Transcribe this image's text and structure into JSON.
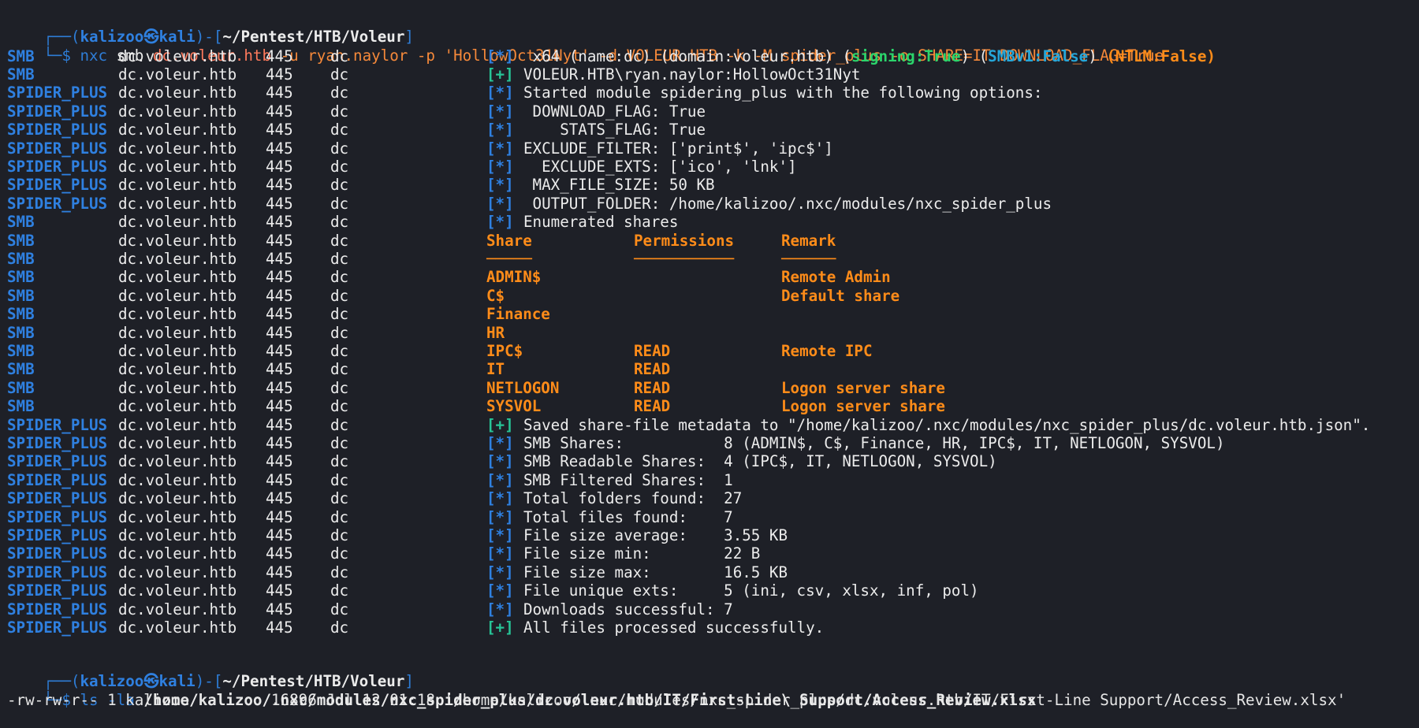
{
  "colors": {
    "background": "#1e2027",
    "prompt_user": "#2f80e0",
    "info_tag": "#2f80e0",
    "success_tag": "#27c497",
    "heading": "#ff8c19",
    "signing": "#2bd46b",
    "smbv1": "#25a6d9"
  },
  "prompt1": {
    "corner": "┌──(",
    "user": "kalizoo",
    "skull": "㉿",
    "host": "kali",
    "mid": ")-[",
    "path": "~/Pentest/HTB/Voleur",
    "end": "]",
    "arrow": "└─$",
    "cmd": "nxc",
    "args": " smb ",
    "target": "dc.voleur.htb",
    "rest": " -u ryan.naylor -p 'HollowOct31Nyt' -d VOLEUR.HTB -k -M spider_plus -o SHARE=IT DOWNLOAD_FLAG=True"
  },
  "rows": [
    {
      "proto": "SMB",
      "host": "dc.voleur.htb",
      "port": "445",
      "name": "dc",
      "tag": "[*]",
      "text": " x64 (name:dc) (domain:voleur.htb) (",
      "signing": "signing:True",
      "t2": ") (",
      "smbv1": "SMBv1:False",
      "t3": ") ",
      "ntlm": "(NTLM:False)"
    },
    {
      "proto": "SMB",
      "host": "dc.voleur.htb",
      "port": "445",
      "name": "dc",
      "tag": "[+]",
      "text": "VOLEUR.HTB\\ryan.naylor:HollowOct31Nyt"
    },
    {
      "proto": "SPIDER_PLUS",
      "host": "dc.voleur.htb",
      "port": "445",
      "name": "dc",
      "tag": "[*]",
      "text": "Started module spidering_plus with the following options:"
    },
    {
      "proto": "SPIDER_PLUS",
      "host": "dc.voleur.htb",
      "port": "445",
      "name": "dc",
      "tag": "[*]",
      "text": " DOWNLOAD_FLAG: True"
    },
    {
      "proto": "SPIDER_PLUS",
      "host": "dc.voleur.htb",
      "port": "445",
      "name": "dc",
      "tag": "[*]",
      "text": "    STATS_FLAG: True"
    },
    {
      "proto": "SPIDER_PLUS",
      "host": "dc.voleur.htb",
      "port": "445",
      "name": "dc",
      "tag": "[*]",
      "text": "EXCLUDE_FILTER: ['print$', 'ipc$']"
    },
    {
      "proto": "SPIDER_PLUS",
      "host": "dc.voleur.htb",
      "port": "445",
      "name": "dc",
      "tag": "[*]",
      "text": "  EXCLUDE_EXTS: ['ico', 'lnk']"
    },
    {
      "proto": "SPIDER_PLUS",
      "host": "dc.voleur.htb",
      "port": "445",
      "name": "dc",
      "tag": "[*]",
      "text": " MAX_FILE_SIZE: 50 KB"
    },
    {
      "proto": "SPIDER_PLUS",
      "host": "dc.voleur.htb",
      "port": "445",
      "name": "dc",
      "tag": "[*]",
      "text": " OUTPUT_FOLDER: /home/kalizoo/.nxc/modules/nxc_spider_plus"
    },
    {
      "proto": "SMB",
      "host": "dc.voleur.htb",
      "port": "445",
      "name": "dc",
      "tag": "[*]",
      "text": "Enumerated shares"
    },
    {
      "proto": "SMB",
      "host": "dc.voleur.htb",
      "port": "445",
      "name": "dc",
      "share": "Share",
      "perm": "Permissions",
      "remark": "Remark"
    },
    {
      "proto": "SMB",
      "host": "dc.voleur.htb",
      "port": "445",
      "name": "dc",
      "share": "─────",
      "perm": "───────────",
      "remark": "──────"
    },
    {
      "proto": "SMB",
      "host": "dc.voleur.htb",
      "port": "445",
      "name": "dc",
      "share": "ADMIN$",
      "perm": "",
      "remark": "Remote Admin"
    },
    {
      "proto": "SMB",
      "host": "dc.voleur.htb",
      "port": "445",
      "name": "dc",
      "share": "C$",
      "perm": "",
      "remark": "Default share"
    },
    {
      "proto": "SMB",
      "host": "dc.voleur.htb",
      "port": "445",
      "name": "dc",
      "share": "Finance",
      "perm": "",
      "remark": ""
    },
    {
      "proto": "SMB",
      "host": "dc.voleur.htb",
      "port": "445",
      "name": "dc",
      "share": "HR",
      "perm": "",
      "remark": ""
    },
    {
      "proto": "SMB",
      "host": "dc.voleur.htb",
      "port": "445",
      "name": "dc",
      "share": "IPC$",
      "perm": "READ",
      "remark": "Remote IPC"
    },
    {
      "proto": "SMB",
      "host": "dc.voleur.htb",
      "port": "445",
      "name": "dc",
      "share": "IT",
      "perm": "READ",
      "remark": ""
    },
    {
      "proto": "SMB",
      "host": "dc.voleur.htb",
      "port": "445",
      "name": "dc",
      "share": "NETLOGON",
      "perm": "READ",
      "remark": "Logon server share"
    },
    {
      "proto": "SMB",
      "host": "dc.voleur.htb",
      "port": "445",
      "name": "dc",
      "share": "SYSVOL",
      "perm": "READ",
      "remark": "Logon server share"
    },
    {
      "proto": "SPIDER_PLUS",
      "host": "dc.voleur.htb",
      "port": "445",
      "name": "dc",
      "tag": "[+]",
      "text": "Saved share-file metadata to \"/home/kalizoo/.nxc/modules/nxc_spider_plus/dc.voleur.htb.json\"."
    },
    {
      "proto": "SPIDER_PLUS",
      "host": "dc.voleur.htb",
      "port": "445",
      "name": "dc",
      "tag": "[*]",
      "text": "SMB Shares:           8 (ADMIN$, C$, Finance, HR, IPC$, IT, NETLOGON, SYSVOL)"
    },
    {
      "proto": "SPIDER_PLUS",
      "host": "dc.voleur.htb",
      "port": "445",
      "name": "dc",
      "tag": "[*]",
      "text": "SMB Readable Shares:  4 (IPC$, IT, NETLOGON, SYSVOL)"
    },
    {
      "proto": "SPIDER_PLUS",
      "host": "dc.voleur.htb",
      "port": "445",
      "name": "dc",
      "tag": "[*]",
      "text": "SMB Filtered Shares:  1"
    },
    {
      "proto": "SPIDER_PLUS",
      "host": "dc.voleur.htb",
      "port": "445",
      "name": "dc",
      "tag": "[*]",
      "text": "Total folders found:  27"
    },
    {
      "proto": "SPIDER_PLUS",
      "host": "dc.voleur.htb",
      "port": "445",
      "name": "dc",
      "tag": "[*]",
      "text": "Total files found:    7"
    },
    {
      "proto": "SPIDER_PLUS",
      "host": "dc.voleur.htb",
      "port": "445",
      "name": "dc",
      "tag": "[*]",
      "text": "File size average:    3.55 KB"
    },
    {
      "proto": "SPIDER_PLUS",
      "host": "dc.voleur.htb",
      "port": "445",
      "name": "dc",
      "tag": "[*]",
      "text": "File size min:        22 B"
    },
    {
      "proto": "SPIDER_PLUS",
      "host": "dc.voleur.htb",
      "port": "445",
      "name": "dc",
      "tag": "[*]",
      "text": "File size max:        16.5 KB"
    },
    {
      "proto": "SPIDER_PLUS",
      "host": "dc.voleur.htb",
      "port": "445",
      "name": "dc",
      "tag": "[*]",
      "text": "File unique exts:     5 (ini, csv, xlsx, inf, pol)"
    },
    {
      "proto": "SPIDER_PLUS",
      "host": "dc.voleur.htb",
      "port": "445",
      "name": "dc",
      "tag": "[*]",
      "text": "Downloads successful: 7"
    },
    {
      "proto": "SPIDER_PLUS",
      "host": "dc.voleur.htb",
      "port": "445",
      "name": "dc",
      "tag": "[+]",
      "text": "All files processed successfully."
    }
  ],
  "prompt2": {
    "corner": "┌──(",
    "user": "kalizoo",
    "skull": "㉿",
    "host": "kali",
    "mid": ")-[",
    "path": "~/Pentest/HTB/Voleur",
    "end": "]",
    "arrow": "└─$",
    "cmd": "ls",
    "args": " -la ",
    "target": "/home/kalizoo/.nxc/modules/nxc_spider_plus/dc.voleur.htb/IT/First-Line\\ Support/Access_Review.xlsx"
  },
  "ls_output": "-rw-rw-r-- 1 kalizoo kalizoo 16896 Jul 12 01:18 '/home/kalizoo/.nxc/modules/nxc_spider_plus/dc.voleur.htb/IT/First-Line Support/Access_Review.xlsx'"
}
